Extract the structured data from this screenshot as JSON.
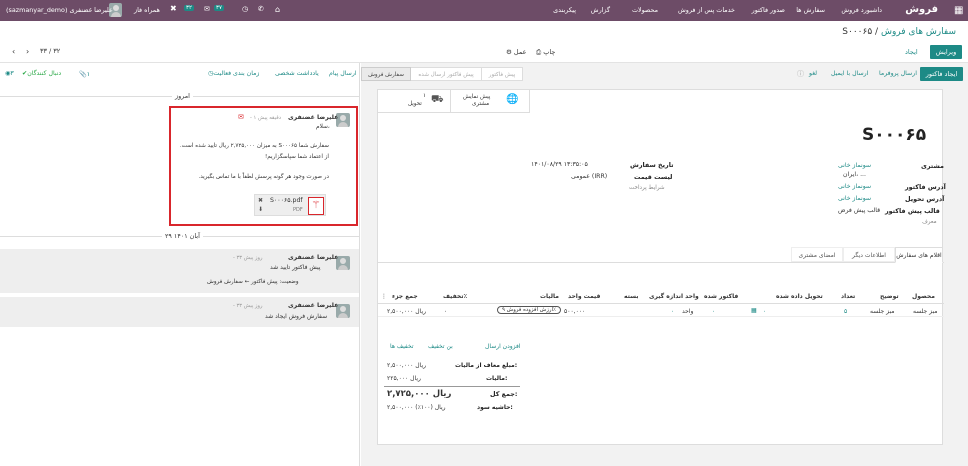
{
  "topbar": {
    "app": "فروش",
    "menu": [
      "داشبورد فروش",
      "سفارش ها",
      "صدور فاکتور",
      "خدمات پس از فروش",
      "محصولات",
      "گزارش",
      "پیکربندی"
    ],
    "user": "علیرضا غضنفری (sazmanyar_demo)",
    "company": "همراه فاز",
    "chat_count": "۳۲",
    "activity_count": "۳۷"
  },
  "breadcrumb": {
    "parent": "سفارش های فروش",
    "current": "S۰۰۰۶۵"
  },
  "actions": {
    "edit": "ویرایش",
    "create": "ایجاد",
    "print": "چاپ",
    "action": "عمل",
    "pager": "۳۳ / ۳۲"
  },
  "statusbar": {
    "create_invoice": "ایجاد فاکتور",
    "send_proforma": "ارسال پروفرما",
    "send_email": "ارسال با ایمیل",
    "cancel": "لغو",
    "steps": [
      "پیش فاکتور",
      "پیش فاکتور ارسال شده",
      "سفارش فروش"
    ]
  },
  "smart": {
    "preview": "پیش نمایش",
    "preview2": "مشتری",
    "delivery_count": "۱",
    "delivery": "تحویل"
  },
  "form": {
    "name": "S۰۰۰۶۵",
    "customer_label": "مشتری",
    "customer": "سونماز خانی",
    "customer_addr": "ایران، ...",
    "invoice_addr_label": "آدرس فاکتور",
    "invoice_addr": "سونماز خانی",
    "delivery_addr_label": "آدرس تحویل",
    "delivery_addr": "سونماز خانی",
    "template_label": "قالب پیش فاکتور",
    "template": "قالب پیش فرض",
    "referrer": "معرف",
    "date_label": "تاریخ سفارش",
    "date": "۱۴۰۱/۰۸/۲۹ ۱۳:۳۵:۰۵",
    "pricelist_label": "لیست قیمت",
    "pricelist": "عمومی (IRR)",
    "payment_terms": "شرایط پرداخت"
  },
  "tabs": [
    "اقلام های سفارش",
    "اطلاعات دیگر",
    "امضای مشتری"
  ],
  "table": {
    "headers": [
      "محصول",
      "توضیح",
      "تعداد",
      "تحویل داده شده",
      "فاکتور شده",
      "واحد اندازه گیری",
      "بسته",
      "قیمت واحد",
      "مالیات",
      "تخفیف٪",
      "جمع جزء"
    ],
    "row": {
      "product": "مبز جلسه",
      "desc": "مبز جلسه",
      "qty": "۵",
      "delivered": "۰",
      "invoiced": "۰",
      "uom": "واحد",
      "unit_price": "۵۰۰,۰۰۰",
      "tax": "ارزش افزوده فروش ۹٪",
      "discount": "۰",
      "subtotal": "۲,۵۰۰,۰۰۰ ریال"
    }
  },
  "links": {
    "shipping": "افزودن ارسال",
    "coupon": "بن تخفیف",
    "promotions": "تخفیف ها"
  },
  "totals": {
    "untaxed_label": "مبلغ معاف از مالیات:",
    "untaxed": "۲,۵۰۰,۰۰۰ ریال",
    "tax_label": "مالیات:",
    "tax": "۲۲۵,۰۰۰ ریال",
    "total_label": "جمع کل:",
    "total": "۲,۷۲۵,۰۰۰ ریال",
    "margin_label": "حاشیه سود:",
    "margin": "۲,۵۰۰,۰۰۰ ریال (۱۰۰٪)"
  },
  "chatter": {
    "send_msg": "ارسال پیام",
    "log_note": "یادداشت شخصی",
    "schedule": "زمان بندی فعالیت",
    "followers": "۳",
    "follow": "دنبال کنندگان",
    "attach": "۱",
    "today": "امروز",
    "date_sep": "۲۹ آبان ۱۴۰۱",
    "m1": {
      "author": "علیرضا غضنفری",
      "time": "- ۱ دقیقه پیش",
      "hello": "سلام،",
      "body1": "سفارش شما S۰۰۰۶۵ به میزان ۲,۷۲۵,۰۰۰ ریال تایید شده است.",
      "body2": "از اعتماد شما سپاسگزاریم!",
      "body3": "در صورت وجود هر گونه پرسش لطفاً با ما تماس بگیرید.",
      "file": "S۰۰۰۶۵.pdf",
      "ext": "PDF"
    },
    "m2": {
      "author": "علیرضا غضنفری",
      "time": "- ۳۳ روز پیش",
      "text": "پیش فاکتور تایید شد",
      "track": "وضعیت: پیش فاکتور ← سفارش فروش"
    },
    "m3": {
      "author": "علیرضا غضنفری",
      "time": "- ۳۳ روز پیش",
      "text": "سفارش فروش ایجاد شد"
    }
  },
  "colors": {
    "brand": "#6d4c67",
    "accent": "#1d8a86",
    "highlight": "#d9262c"
  }
}
